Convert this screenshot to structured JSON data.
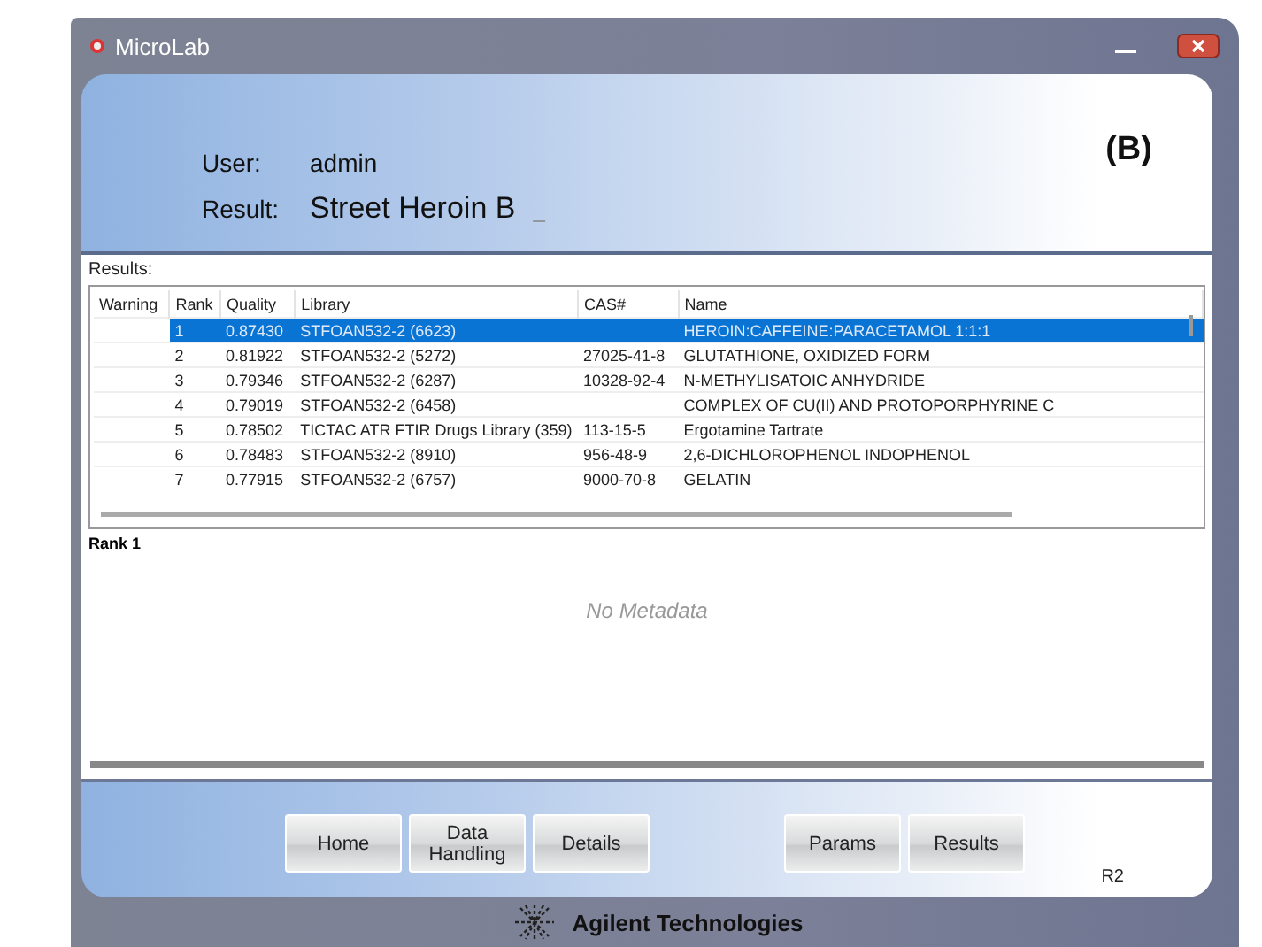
{
  "window": {
    "title": "MicroLab"
  },
  "header": {
    "user_label": "User:",
    "user_value": "admin",
    "result_label": "Result:",
    "result_value": "Street Heroin B",
    "result_cursor": "_",
    "panel_tag": "(B)"
  },
  "results": {
    "label": "Results:",
    "columns": [
      "Warning",
      "Rank",
      "Quality",
      "Library",
      "CAS#",
      "Name"
    ],
    "rows": [
      {
        "rank": "1",
        "quality": "0.87430",
        "library": "STFOAN532-2 (6623)",
        "name": "HEROIN:CAFFEINE:PARACETAMOL 1:1:1",
        "selected": true
      },
      {
        "rank": "2",
        "quality": "0.81922",
        "library": "STFOAN532-2 (5272)",
        "cas": "27025-41-8",
        "name": "GLUTATHIONE, OXIDIZED FORM",
        "selected": false
      },
      {
        "rank": "3",
        "quality": "0.79346",
        "library": "STFOAN532-2 (6287)",
        "cas": "10328-92-4",
        "name": "N-METHYLISATOIC ANHYDRIDE",
        "selected": false
      },
      {
        "rank": "4",
        "quality": "0.79019",
        "library": "STFOAN532-2 (6458)",
        "name": "COMPLEX OF CU(II) AND PROTOPORPHYRINE C",
        "selected": false
      },
      {
        "rank": "5",
        "quality": "0.78502",
        "library": "TICTAC ATR FTIR Drugs Library (359)",
        "cas": "113-15-5",
        "name": "Ergotamine Tartrate",
        "selected": false
      },
      {
        "rank": "6",
        "quality": "0.78483",
        "library": "STFOAN532-2 (8910)",
        "cas": "956-48-9",
        "name": "2,6-DICHLOROPHENOL INDOPHENOL",
        "selected": false
      },
      {
        "rank": "7",
        "quality": "0.77915",
        "library": "STFOAN532-2 (6757)",
        "cas": "9000-70-8",
        "name": "GELATIN",
        "selected": false
      }
    ]
  },
  "detail": {
    "title": "Rank 1",
    "message": "No Metadata"
  },
  "buttons_left": [
    "Home",
    "Data Handling",
    "Details"
  ],
  "buttons_right": [
    "Params",
    "Results"
  ],
  "version": "R2",
  "brand": "Agilent Technologies"
}
